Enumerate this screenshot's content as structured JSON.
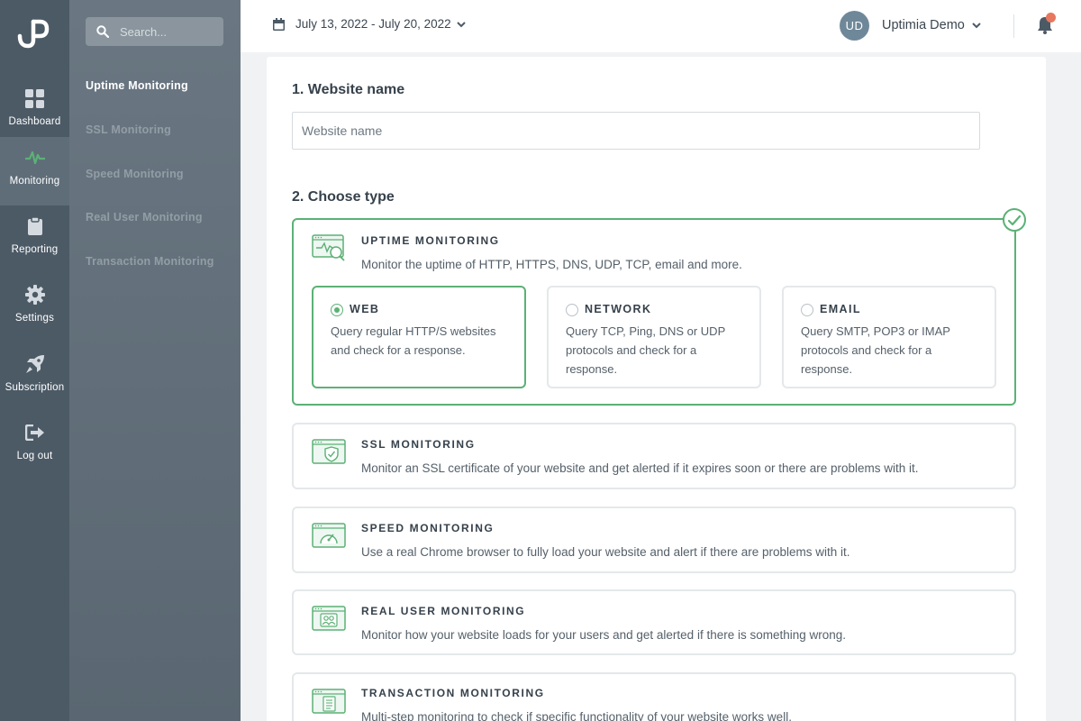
{
  "brand": {
    "logo_icon": "up-logo-icon"
  },
  "rail": {
    "items": [
      {
        "label": "Dashboard",
        "icon": "dashboard-icon"
      },
      {
        "label": "Monitoring",
        "icon": "pulse-icon",
        "active": true
      },
      {
        "label": "Reporting",
        "icon": "clipboard-icon"
      },
      {
        "label": "Settings",
        "icon": "gear-icon"
      },
      {
        "label": "Subscription",
        "icon": "rocket-icon"
      },
      {
        "label": "Log out",
        "icon": "logout-icon"
      }
    ]
  },
  "subnav": {
    "search_placeholder": "Search...",
    "items": [
      {
        "label": "Uptime Monitoring",
        "active": true
      },
      {
        "label": "SSL Monitoring"
      },
      {
        "label": "Speed Monitoring"
      },
      {
        "label": "Real User Monitoring"
      },
      {
        "label": "Transaction Monitoring"
      }
    ]
  },
  "topbar": {
    "date_range": "July 13, 2022 - July 20, 2022",
    "user_initials": "UD",
    "user_name": "Uptimia Demo",
    "notification_dot": true
  },
  "form": {
    "section1_title": "1. Website name",
    "website_placeholder": "Website name",
    "website_value": "",
    "section2_title": "2. Choose type",
    "types": [
      {
        "title": "UPTIME MONITORING",
        "desc": "Monitor the uptime of HTTP, HTTPS, DNS, UDP, TCP, email and more.",
        "icon": "uptime-monitor-icon",
        "selected": true,
        "subtypes": [
          {
            "title": "WEB",
            "desc": "Query regular HTTP/S websites and check for a response.",
            "selected": true
          },
          {
            "title": "NETWORK",
            "desc": "Query TCP, Ping, DNS or UDP protocols and check for a response.",
            "selected": false
          },
          {
            "title": "EMAIL",
            "desc": "Query SMTP, POP3 or IMAP protocols and check for a response.",
            "selected": false
          }
        ]
      },
      {
        "title": "SSL MONITORING",
        "desc": "Monitor an SSL certificate of your website and get alerted if it expires soon or there are problems with it.",
        "icon": "ssl-shield-icon"
      },
      {
        "title": "SPEED MONITORING",
        "desc": "Use a real Chrome browser to fully load your website and alert if there are problems with it.",
        "icon": "speedometer-icon"
      },
      {
        "title": "REAL USER MONITORING",
        "desc": "Monitor how your website loads for your users and get alerted if there is something wrong.",
        "icon": "users-icon"
      },
      {
        "title": "TRANSACTION MONITORING",
        "desc": "Multi-step monitoring to check if specific functionality of your website works well.",
        "icon": "document-list-icon"
      }
    ]
  },
  "colors": {
    "accent": "#5cb176",
    "rail_bg": "#4c5a66",
    "subnav_bg": "#606d78",
    "avatar_bg": "#6f8899",
    "notification": "#e8775f"
  }
}
